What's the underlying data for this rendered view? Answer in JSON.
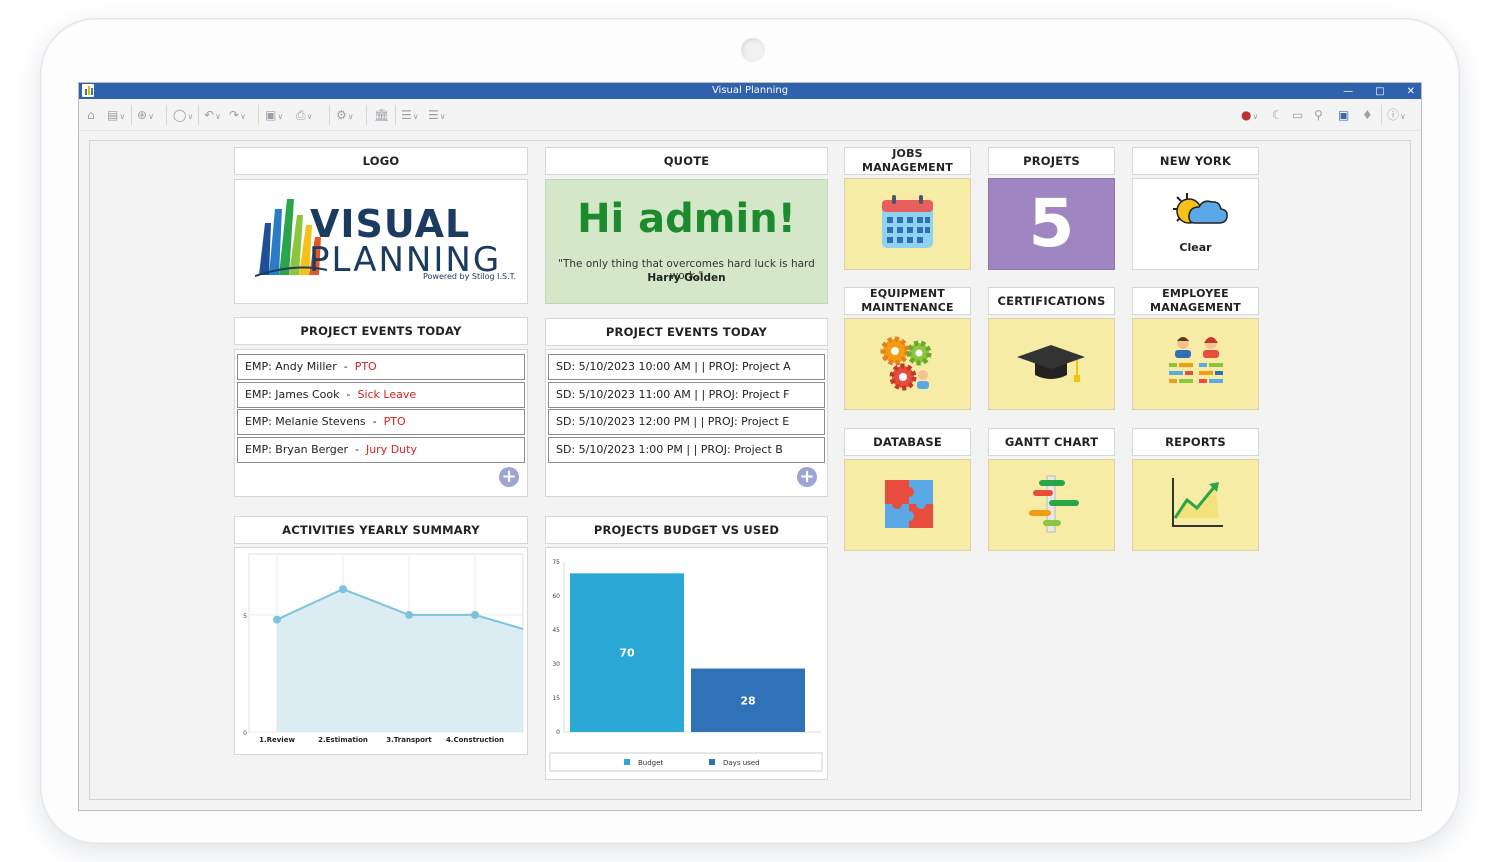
{
  "window": {
    "title": "Visual Planning"
  },
  "logo": {
    "header": "LOGO",
    "title": "VISUAL",
    "subtitle": "PLANNING",
    "tagline": "Powered by Stilog I.S.T."
  },
  "quote": {
    "header": "QUOTE",
    "greeting": "Hi admin!",
    "text": "\"The only thing that overcomes hard luck is hard work.\"",
    "author": "Harry Golden"
  },
  "events_emp": {
    "header": "PROJECT EVENTS TODAY",
    "rows": [
      {
        "name": "EMP: Andy Miller",
        "status": "PTO"
      },
      {
        "name": "EMP: James Cook",
        "status": "Sick Leave"
      },
      {
        "name": "EMP: Melanie Stevens",
        "status": "PTO"
      },
      {
        "name": "EMP: Bryan Berger",
        "status": "Jury Duty"
      }
    ]
  },
  "events_proj": {
    "header": "PROJECT EVENTS TODAY",
    "rows": [
      "SD: 5/10/2023 10:00 AM | | PROJ: Project A",
      "SD: 5/10/2023 11:00 AM | | PROJ: Project F",
      "SD: 5/10/2023 12:00 PM | | PROJ: Project E",
      "SD: 5/10/2023 1:00 PM | | PROJ: Project B"
    ]
  },
  "separator": "-",
  "add_symbol": "+",
  "activities": {
    "header": "ACTIVITIES YEARLY SUMMARY"
  },
  "budget": {
    "header": "PROJECTS BUDGET VS USED"
  },
  "chart_data": [
    {
      "type": "area",
      "categories": [
        "1.Review",
        "2.Estimation",
        "3.Transport",
        "4.Construction"
      ],
      "values": [
        4.8,
        6.1,
        5.0,
        5.0,
        4.4
      ],
      "yticks": [
        0,
        5
      ],
      "ylim": [
        0,
        7.6
      ],
      "grid": true,
      "color": "#7ec3de"
    },
    {
      "type": "bar",
      "series": [
        {
          "name": "Budget",
          "values": [
            70
          ],
          "color": "#2aa9d6"
        },
        {
          "name": "Days used",
          "values": [
            28
          ],
          "color": "#2f72b8"
        }
      ],
      "yticks": [
        0,
        15,
        30,
        45,
        60,
        75
      ],
      "ylim": [
        0,
        75
      ],
      "legend": "bottom"
    }
  ],
  "tiles": {
    "jobs": {
      "label": "JOBS\nMANAGEMENT",
      "icon": "calendar-icon"
    },
    "projects": {
      "label": "PROJETS",
      "value": "5"
    },
    "weather": {
      "label": "NEW YORK",
      "condition": "Clear",
      "icon": "weather-icon"
    },
    "equipment": {
      "label": "EQUIPMENT\nMAINTENANCE",
      "icon": "gears-icon"
    },
    "certifications": {
      "label": "CERTIFICATIONS",
      "icon": "graduation-cap-icon"
    },
    "employees": {
      "label": "EMPLOYEE\nMANAGEMENT",
      "icon": "employees-icon"
    },
    "database": {
      "label": "DATABASE",
      "icon": "puzzle-icon"
    },
    "gantt": {
      "label": "GANTT CHART",
      "icon": "gantt-icon"
    },
    "reports": {
      "label": "REPORTS",
      "icon": "line-chart-icon"
    }
  },
  "colors": {
    "title_bar": "#2f61ad",
    "tile_yellow": "#f6eca6",
    "tile_purple": "#9f86c0",
    "status_red": "#d42020"
  }
}
